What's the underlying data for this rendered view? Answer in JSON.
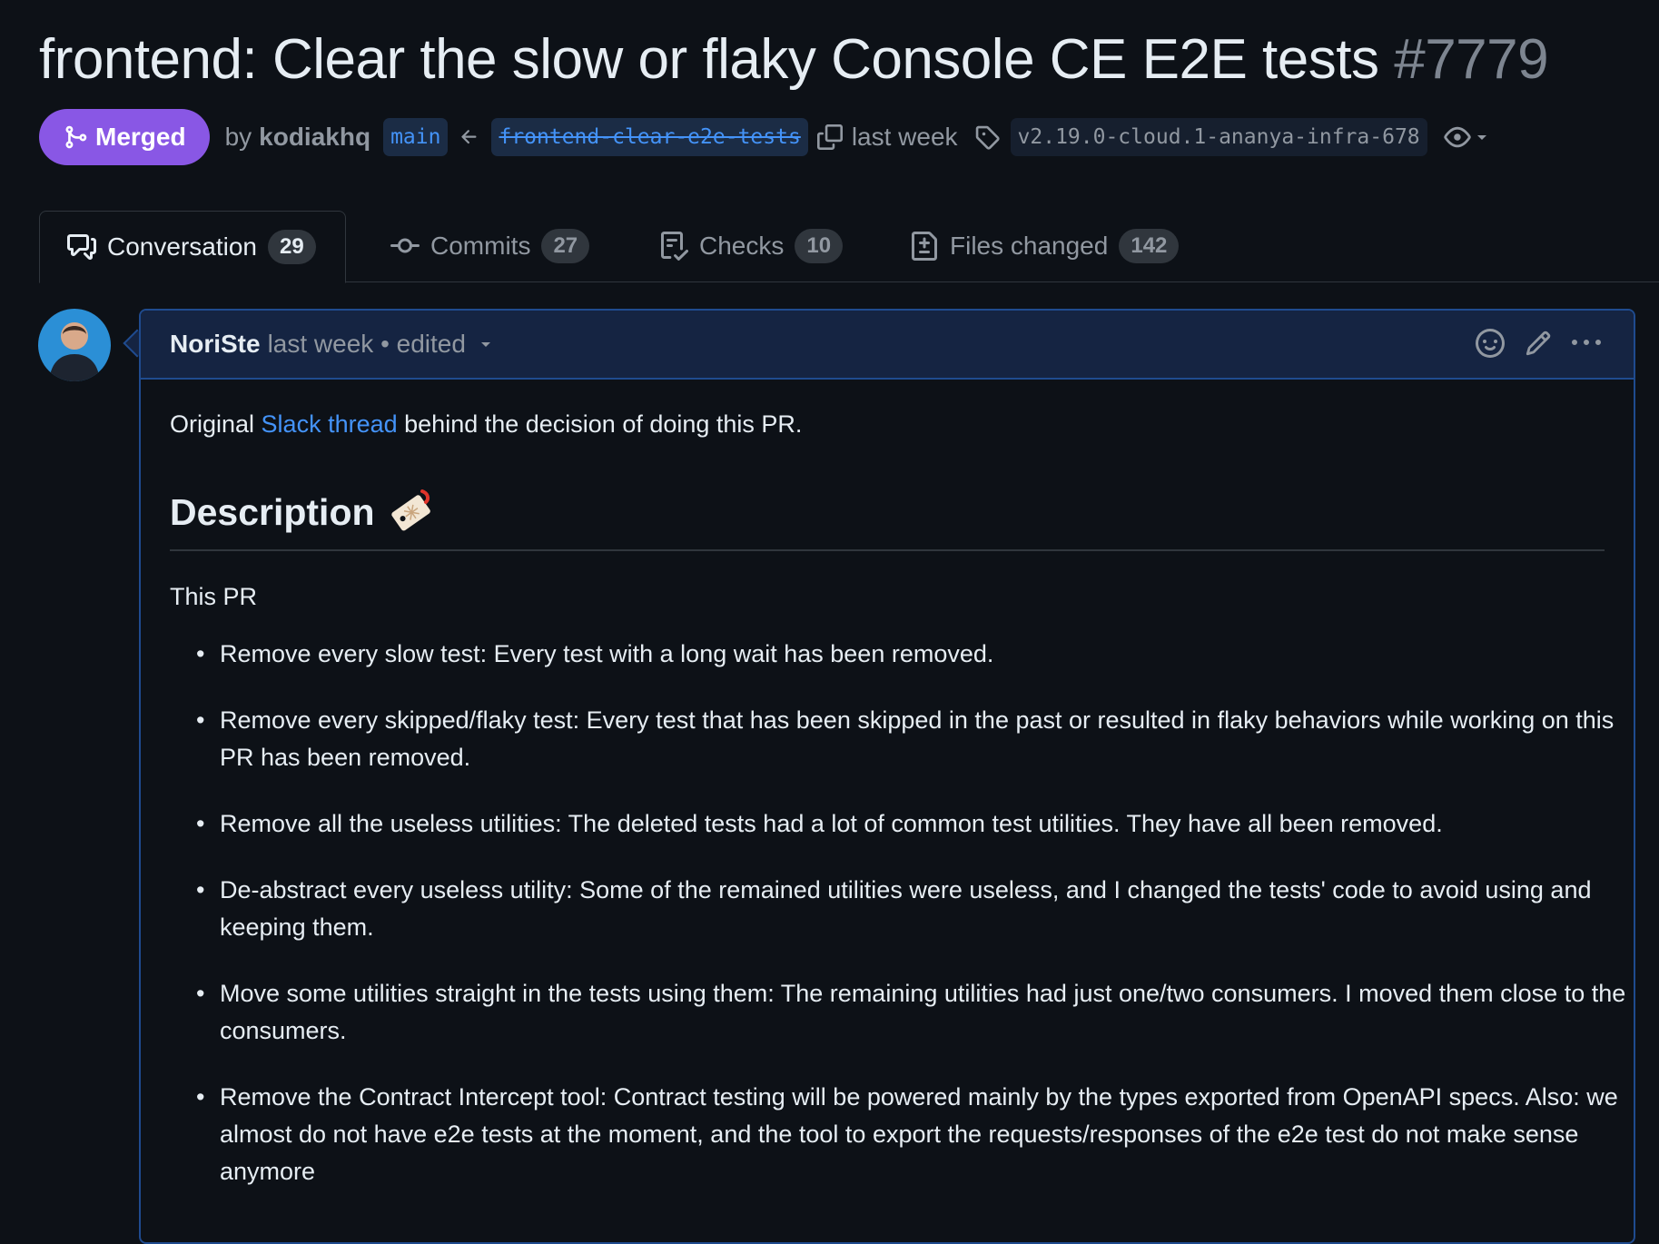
{
  "pr": {
    "title": "frontend: Clear the slow or flaky Console CE E2E tests",
    "number": "#7779",
    "status": "Merged",
    "by": "by",
    "author": "kodiakhq",
    "base_branch": "main",
    "head_branch": "frontend-clear-e2e-tests",
    "when": "last week",
    "tag": "v2.19.0-cloud.1-ananya-infra-678"
  },
  "tabs": [
    {
      "label": "Conversation",
      "count": "29",
      "icon": "comment-discussion-icon"
    },
    {
      "label": "Commits",
      "count": "27",
      "icon": "git-commit-icon"
    },
    {
      "label": "Checks",
      "count": "10",
      "icon": "checklist-icon"
    },
    {
      "label": "Files changed",
      "count": "142",
      "icon": "file-diff-icon"
    }
  ],
  "comment": {
    "user": "NoriSte",
    "meta": "last week • edited",
    "intro_before": "Original ",
    "intro_link": "Slack thread",
    "intro_after": " behind the decision of doing this PR.",
    "heading": "Description",
    "lead": "This PR",
    "items": [
      "Remove every slow test: Every test with a long wait has been removed.",
      "Remove every skipped/flaky test: Every test that has been skipped in the past or resulted in flaky behaviors while working on this PR has been removed.",
      "Remove all the useless utilities: The deleted tests had a lot of common test utilities. They have all been removed.",
      "De-abstract every useless utility: Some of the remained utilities were useless, and I changed the tests' code to avoid using and keeping them.",
      "Move some utilities straight in the tests using them: The remaining utilities had just one/two consumers. I moved them close to the consumers.",
      "Remove the Contract Intercept tool: Contract testing will be powered mainly by the types exported from OpenAPI specs. Also: we almost do not have e2e tests at the moment, and the tool to export the requests/responses of the e2e test do not make sense anymore"
    ]
  },
  "colors": {
    "background": "#0d1117",
    "merged": "#8957e5",
    "link": "#4493f8",
    "comment_header": "#152442"
  }
}
